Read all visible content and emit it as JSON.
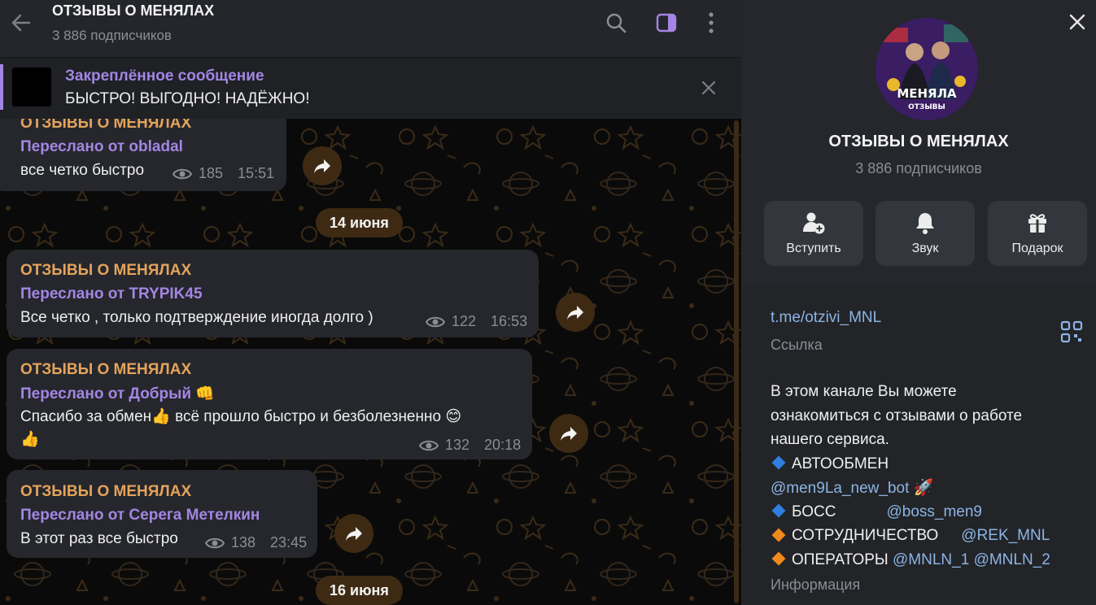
{
  "header": {
    "title": "ОТЗЫВЫ О МЕНЯЛАХ",
    "subscribers": "3 886 подписчиков"
  },
  "pinned": {
    "title": "Закреплённое сообщение",
    "text": "БЫСТРО! ВЫГОДНО! НАДЁЖНО!"
  },
  "messages": [
    {
      "channel": "ОТЗЫВЫ О МЕНЯЛАХ",
      "forwarded": "Переслано от obladal",
      "text": "все четко быстро",
      "text2": "",
      "views": "185",
      "time": "15:51"
    },
    {
      "channel": "ОТЗЫВЫ О МЕНЯЛАХ",
      "forwarded": "Переслано от TRYPIK45",
      "text": "Все четко , только подтверждение иногда долго )",
      "text2": "",
      "views": "122",
      "time": "16:53"
    },
    {
      "channel": "ОТЗЫВЫ О МЕНЯЛАХ",
      "forwarded": "Переслано от Добрый 👊",
      "text": "Спасибо за обмен👍 всё прошло быстро и безболезненно 😊",
      "text2": "👍",
      "views": "132",
      "time": "20:18"
    },
    {
      "channel": "ОТЗЫВЫ О МЕНЯЛАХ",
      "forwarded": "Переслано от Серега Метелкин",
      "text": "В этот раз все быстро",
      "text2": "",
      "views": "138",
      "time": "23:45"
    }
  ],
  "dates": [
    "14 июня",
    "16 июня"
  ],
  "profile": {
    "title": "ОТЗЫВЫ О МЕНЯЛАХ",
    "subscribers": "3 886 подписчиков",
    "avatar_text": "МЕНЯЛА",
    "avatar_sub": "ОТЗЫВЫ",
    "actions": [
      "Вступить",
      "Звук",
      "Подарок"
    ],
    "link": "t.me/otzivi_MNL",
    "link_label": "Ссылка",
    "description": {
      "line1": "В этом канале Вы можете",
      "line2": "ознакомиться с отзывами о работе",
      "line3": "нашего сервиса.",
      "autoexchange": "АВТООБМЕН",
      "bot": "@men9La_new_bot",
      "rocket": "🚀",
      "boss": "БОСС",
      "boss_handle": "@boss_men9",
      "coop": "СОТРУДНИЧЕСТВО",
      "coop_handle": "@REK_MNL",
      "operators": "ОПЕРАТОРЫ",
      "op1": "@MNLN_1",
      "op2": "@MNLN_2"
    },
    "info_label": "Информация"
  },
  "colors": {
    "accent_purple": "#a485e4",
    "channel_orange": "#e5a35a",
    "link_blue": "#8cb4e4",
    "bubble": "#25272c",
    "pill_brown": "#3e2a13"
  },
  "icons": [
    "back-arrow-icon",
    "search-icon",
    "sidebar-toggle-icon",
    "more-vertical-icon",
    "close-icon",
    "forward-icon",
    "eye-icon",
    "add-user-icon",
    "bell-icon",
    "gift-icon",
    "qr-code-icon"
  ]
}
